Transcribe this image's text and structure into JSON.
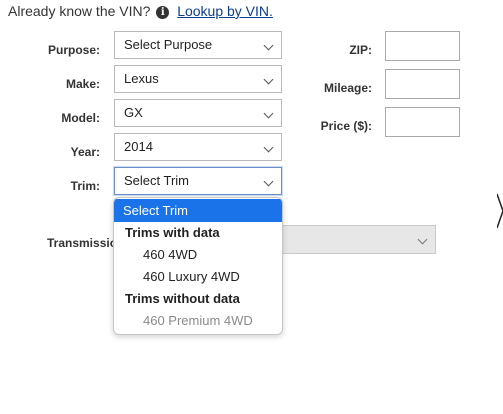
{
  "vin_prompt": {
    "question": "Already know the VIN?",
    "info_icon": "info-icon",
    "link": "Lookup by VIN."
  },
  "form": {
    "purpose": {
      "label": "Purpose:",
      "value": "Select Purpose"
    },
    "make": {
      "label": "Make:",
      "value": "Lexus"
    },
    "model": {
      "label": "Model:",
      "value": "GX"
    },
    "year": {
      "label": "Year:",
      "value": "2014"
    },
    "trim": {
      "label": "Trim:",
      "value": "Select Trim"
    },
    "transmission": {
      "label": "Transmission",
      "value": ""
    },
    "zip": {
      "label": "ZIP:",
      "value": ""
    },
    "mileage": {
      "label": "Mileage:",
      "value": ""
    },
    "price": {
      "label": "Price ($):",
      "value": ""
    }
  },
  "trim_dropdown": {
    "selected": "Select Trim",
    "groups": [
      {
        "label": "Trims with data",
        "options": [
          "460 4WD",
          "460 Luxury 4WD"
        ],
        "disabled": false
      },
      {
        "label": "Trims without data",
        "options": [
          "460 Premium 4WD"
        ],
        "disabled": true
      }
    ]
  },
  "colors": {
    "link": "#0b3d91",
    "selected_option_bg": "#1a73e8",
    "disabled_text": "#8a8a8a"
  }
}
